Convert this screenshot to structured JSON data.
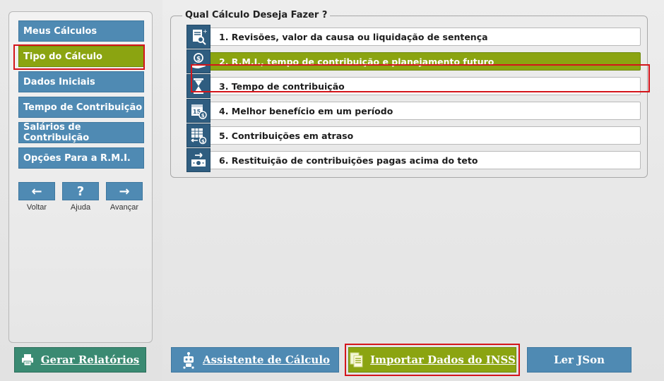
{
  "sidebar": {
    "items": [
      {
        "label": "Meus Cálculos",
        "active": false
      },
      {
        "label": "Tipo do Cálculo",
        "active": true
      },
      {
        "label": "Dados Iniciais",
        "active": false
      },
      {
        "label": "Tempo de Contribuição",
        "active": false
      },
      {
        "label": "Salários de Contribuição",
        "active": false
      },
      {
        "label": "Opções Para a R.M.I.",
        "active": false
      }
    ],
    "nav_buttons": [
      {
        "glyph": "←",
        "label": "Voltar",
        "icon": "arrow-left-icon"
      },
      {
        "glyph": "?",
        "label": "Ajuda",
        "icon": "help-icon"
      },
      {
        "glyph": "→",
        "label": "Avançar",
        "icon": "arrow-right-icon"
      }
    ],
    "report_button": {
      "label": "Gerar Relatórios",
      "icon": "printer-icon"
    }
  },
  "main": {
    "group_title": "Qual Cálculo Deseja Fazer ?",
    "options": [
      {
        "label": "1. Revisões, valor da causa ou liquidação de sentença",
        "icon": "document-search-icon",
        "selected": false
      },
      {
        "label": "2. R.M.I., tempo de contribuição e planejamento futuro",
        "icon": "money-hand-icon",
        "selected": true
      },
      {
        "label": "3. Tempo de contribuição",
        "icon": "hourglass-icon",
        "selected": false
      },
      {
        "label": "4. Melhor benefício em um período",
        "icon": "calendar-money-icon",
        "selected": false
      },
      {
        "label": "5. Contribuições em atraso",
        "icon": "calendar-arrows-icon",
        "selected": false
      },
      {
        "label": "6. Restituição de contribuições pagas acima do teto",
        "icon": "money-refund-icon",
        "selected": false
      }
    ],
    "bottom_buttons": {
      "assistant": {
        "label": "Assistente de Cálculo",
        "icon": "robot-icon"
      },
      "import": {
        "label": "Importar Dados do INSS",
        "icon": "documents-icon"
      },
      "json": {
        "label": "Ler JSon"
      }
    }
  },
  "colors": {
    "blue": "#4f8ab3",
    "green": "#8ba411",
    "teal": "#3a8a72",
    "highlight_red": "#d4141a",
    "icon_bg": "#2f5d80"
  }
}
